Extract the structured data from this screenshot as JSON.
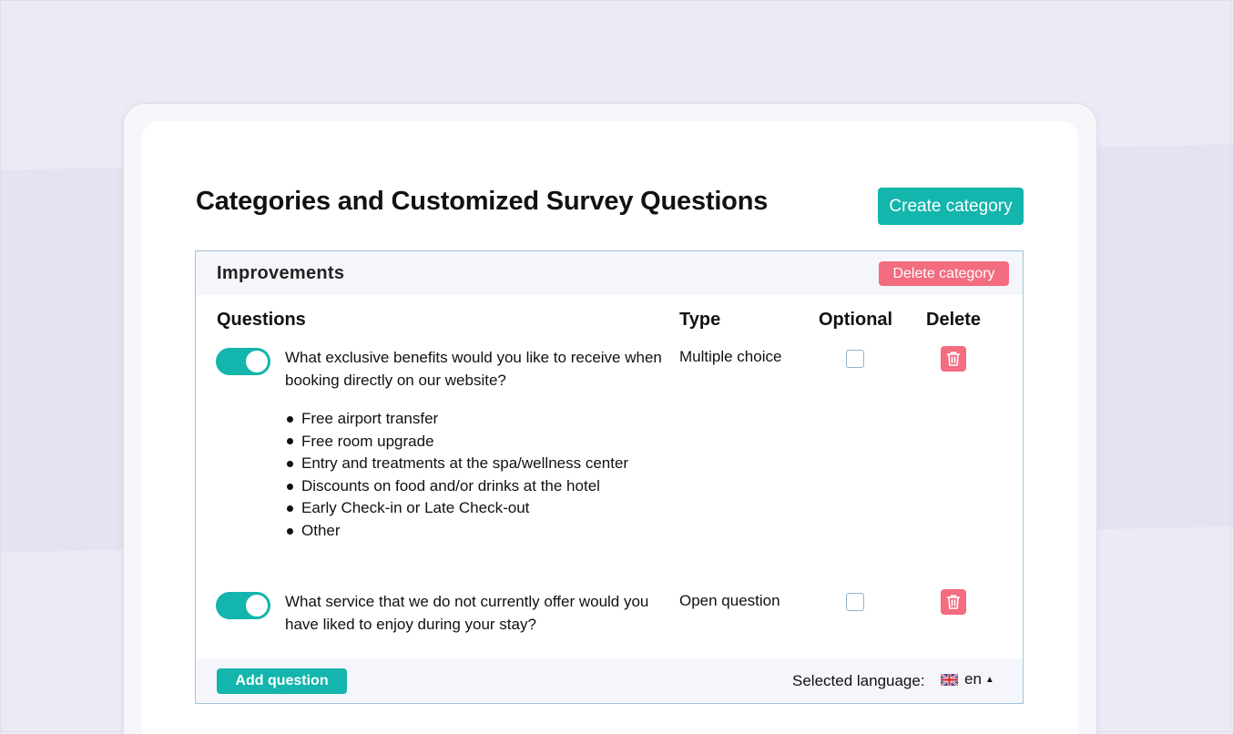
{
  "page": {
    "title": "Categories and Customized Survey Questions",
    "create_label": "Create category"
  },
  "category": {
    "name": "Improvements",
    "delete_label": "Delete category",
    "columns": {
      "questions": "Questions",
      "type": "Type",
      "optional": "Optional",
      "delete": "Delete"
    },
    "questions": [
      {
        "enabled": true,
        "text": "What exclusive benefits would you like to receive when booking directly on our website?",
        "type": "Multiple choice",
        "optional": false,
        "options": [
          "Free airport transfer",
          "Free room upgrade",
          "Entry and treatments at the spa/wellness center",
          "Discounts on food and/or drinks at the hotel",
          "Early Check-in or Late Check-out",
          "Other"
        ]
      },
      {
        "enabled": true,
        "text": "What service that we do not currently offer would you have liked to enjoy during your stay?",
        "type": "Open question",
        "optional": false
      }
    ],
    "add_question_label": "Add question",
    "language_label": "Selected language:",
    "language": "en",
    "language_flag_icon": "uk-flag-icon"
  },
  "colors": {
    "accent": "#13b5ac",
    "danger": "#f36c7f",
    "background": "#ecebf5"
  }
}
